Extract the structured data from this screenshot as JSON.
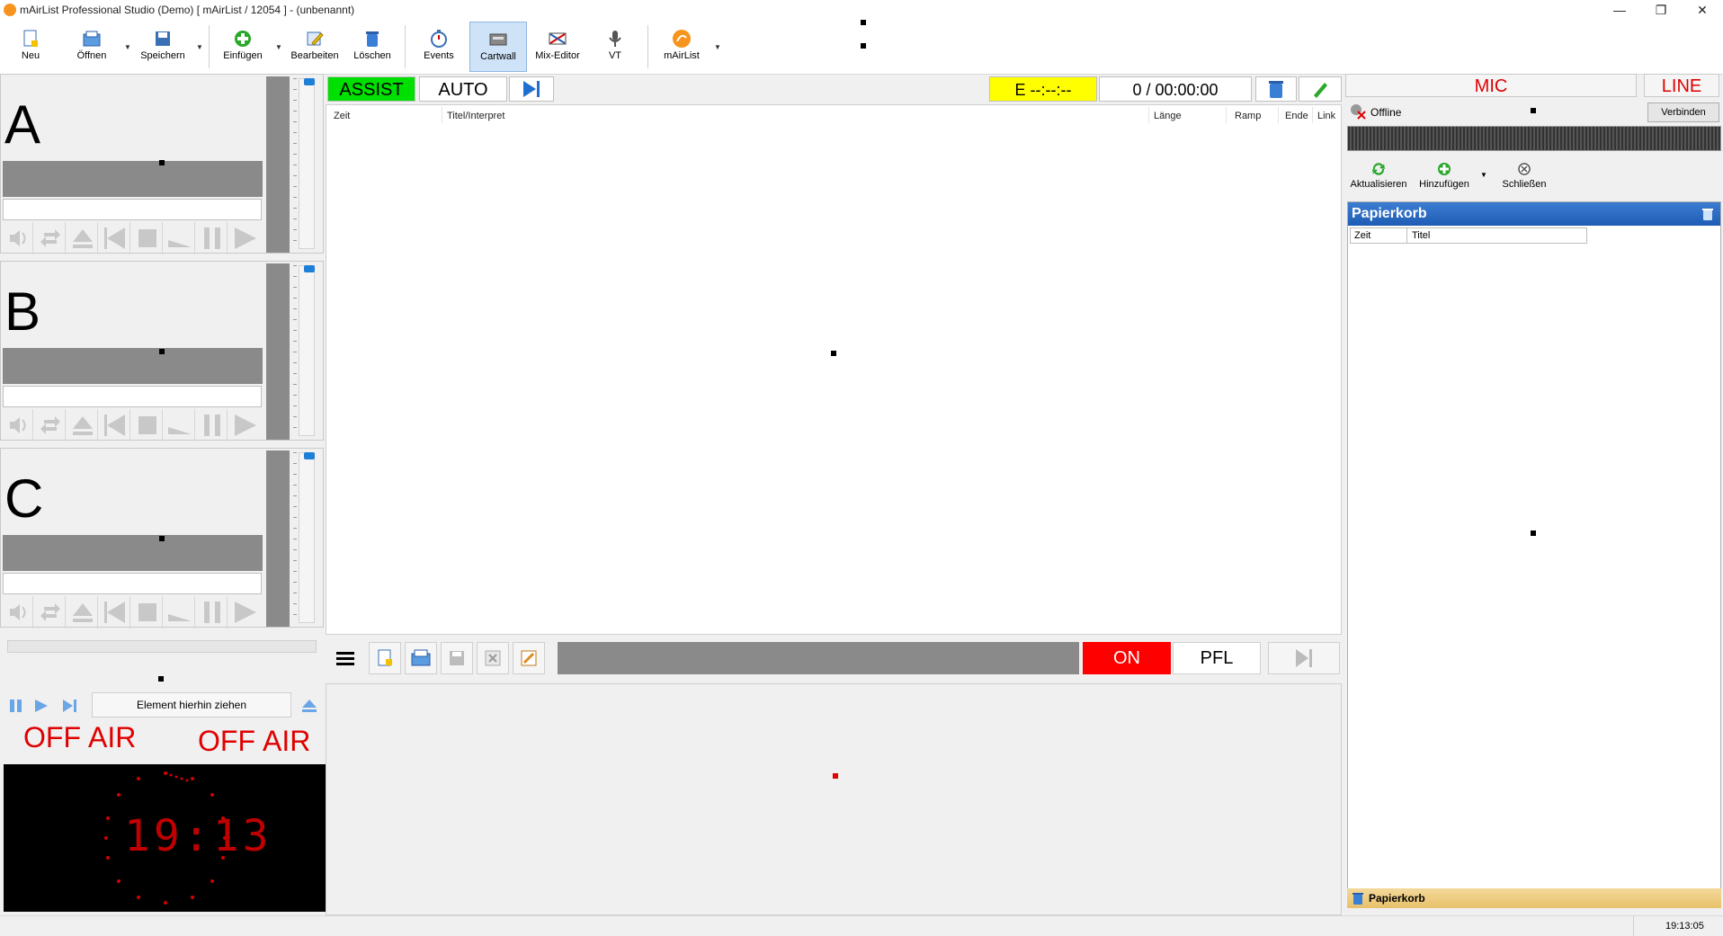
{
  "window": {
    "title": "mAirList Professional Studio (Demo) [ mAirList / 12054 ] - (unbenannt)",
    "min": "—",
    "restore": "❐",
    "close": "✕"
  },
  "toolbar": {
    "items": [
      {
        "label": "Neu",
        "icon": "new-document-icon"
      },
      {
        "label": "Öffnen",
        "icon": "open-folder-icon"
      },
      {
        "label": "Speichern",
        "icon": "save-icon"
      },
      {
        "label": "Einfügen",
        "icon": "insert-plus-icon"
      },
      {
        "label": "Bearbeiten",
        "icon": "edit-icon"
      },
      {
        "label": "Löschen",
        "icon": "trash-icon"
      },
      {
        "label": "Events",
        "icon": "stopwatch-icon"
      },
      {
        "label": "Cartwall",
        "icon": "cartwall-icon"
      },
      {
        "label": "Mix-Editor",
        "icon": "mix-editor-icon"
      },
      {
        "label": "VT",
        "icon": "microphone-icon"
      },
      {
        "label": "mAirList",
        "icon": "mairlist-logo-icon"
      }
    ]
  },
  "decks": [
    {
      "letter": "A"
    },
    {
      "letter": "B"
    },
    {
      "letter": "C"
    }
  ],
  "playlist": {
    "mode_assist": "ASSIST",
    "mode_auto": "AUTO",
    "eta": "E  --:--:--",
    "count_time": "0 / 00:00:00",
    "columns": [
      "Zeit",
      "Titel/Interpret",
      "Länge",
      "Ramp",
      "Ende",
      "Link"
    ]
  },
  "player": {
    "on_label": "ON",
    "pfl_label": "PFL",
    "dropzone": "Element hierhin ziehen"
  },
  "onair": {
    "left_off": "OFF",
    "left_air": "AIR",
    "right_off": "OFF",
    "right_air": "AIR"
  },
  "clock": {
    "display": "19:13"
  },
  "right": {
    "mic": "MIC",
    "line": "LINE",
    "status": "Offline",
    "connect": "Verbinden",
    "refresh": "Aktualisieren",
    "add": "Hinzufügen",
    "close": "Schließen",
    "bin_title": "Papierkorb",
    "bin_columns": [
      "Zeit",
      "Titel"
    ],
    "bin_footer": "Papierkorb"
  },
  "statusbar": {
    "time": "19:13:05"
  },
  "colors": {
    "assist_green": "#00e000",
    "eta_yellow": "#ffff00",
    "on_red": "#ff0000",
    "offair_red": "#e00000",
    "bin_blue": "#1f5cb5"
  }
}
